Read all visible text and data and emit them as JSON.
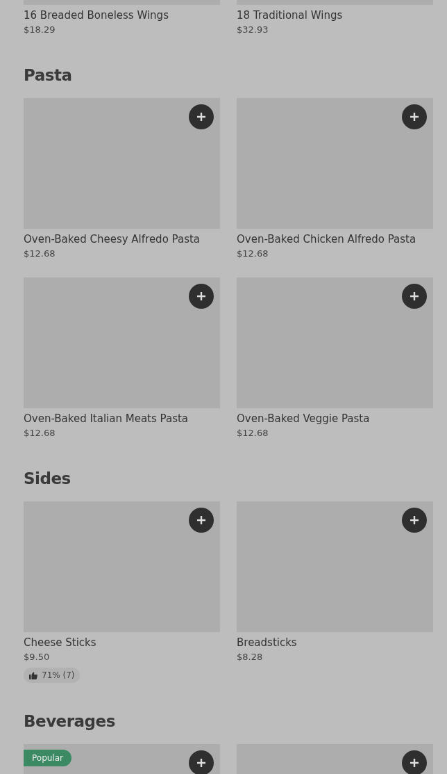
{
  "sections": [
    {
      "items": [
        {
          "kind": "dish",
          "name": "16 Breaded Boneless Wings",
          "price": "$18.29"
        },
        {
          "kind": "dish",
          "name": "18 Traditional Wings",
          "price": "$32.93"
        }
      ]
    },
    {
      "title": "Pasta",
      "items": [
        {
          "kind": "dish",
          "name": "Oven-Baked Cheesy Alfredo Pasta",
          "price": "$12.68"
        },
        {
          "kind": "dish",
          "name": "Oven-Baked Chicken Alfredo Pasta",
          "price": "$12.68"
        },
        {
          "kind": "dish",
          "name": "Oven-Baked Italian Meats Pasta",
          "price": "$12.68"
        },
        {
          "kind": "dish",
          "name": "Oven-Baked Veggie Pasta",
          "price": "$12.68"
        }
      ]
    },
    {
      "title": "Sides",
      "items": [
        {
          "kind": "dish",
          "name": "Cheese Sticks",
          "price": "$9.50",
          "rating": "71% (7)"
        },
        {
          "kind": "dish",
          "name": "Breadsticks",
          "price": "$8.28"
        }
      ]
    },
    {
      "title": "Beverages",
      "items": [
        {
          "kind": "dish",
          "tag": "Popular"
        },
        {
          "kind": "dish"
        }
      ]
    }
  ]
}
